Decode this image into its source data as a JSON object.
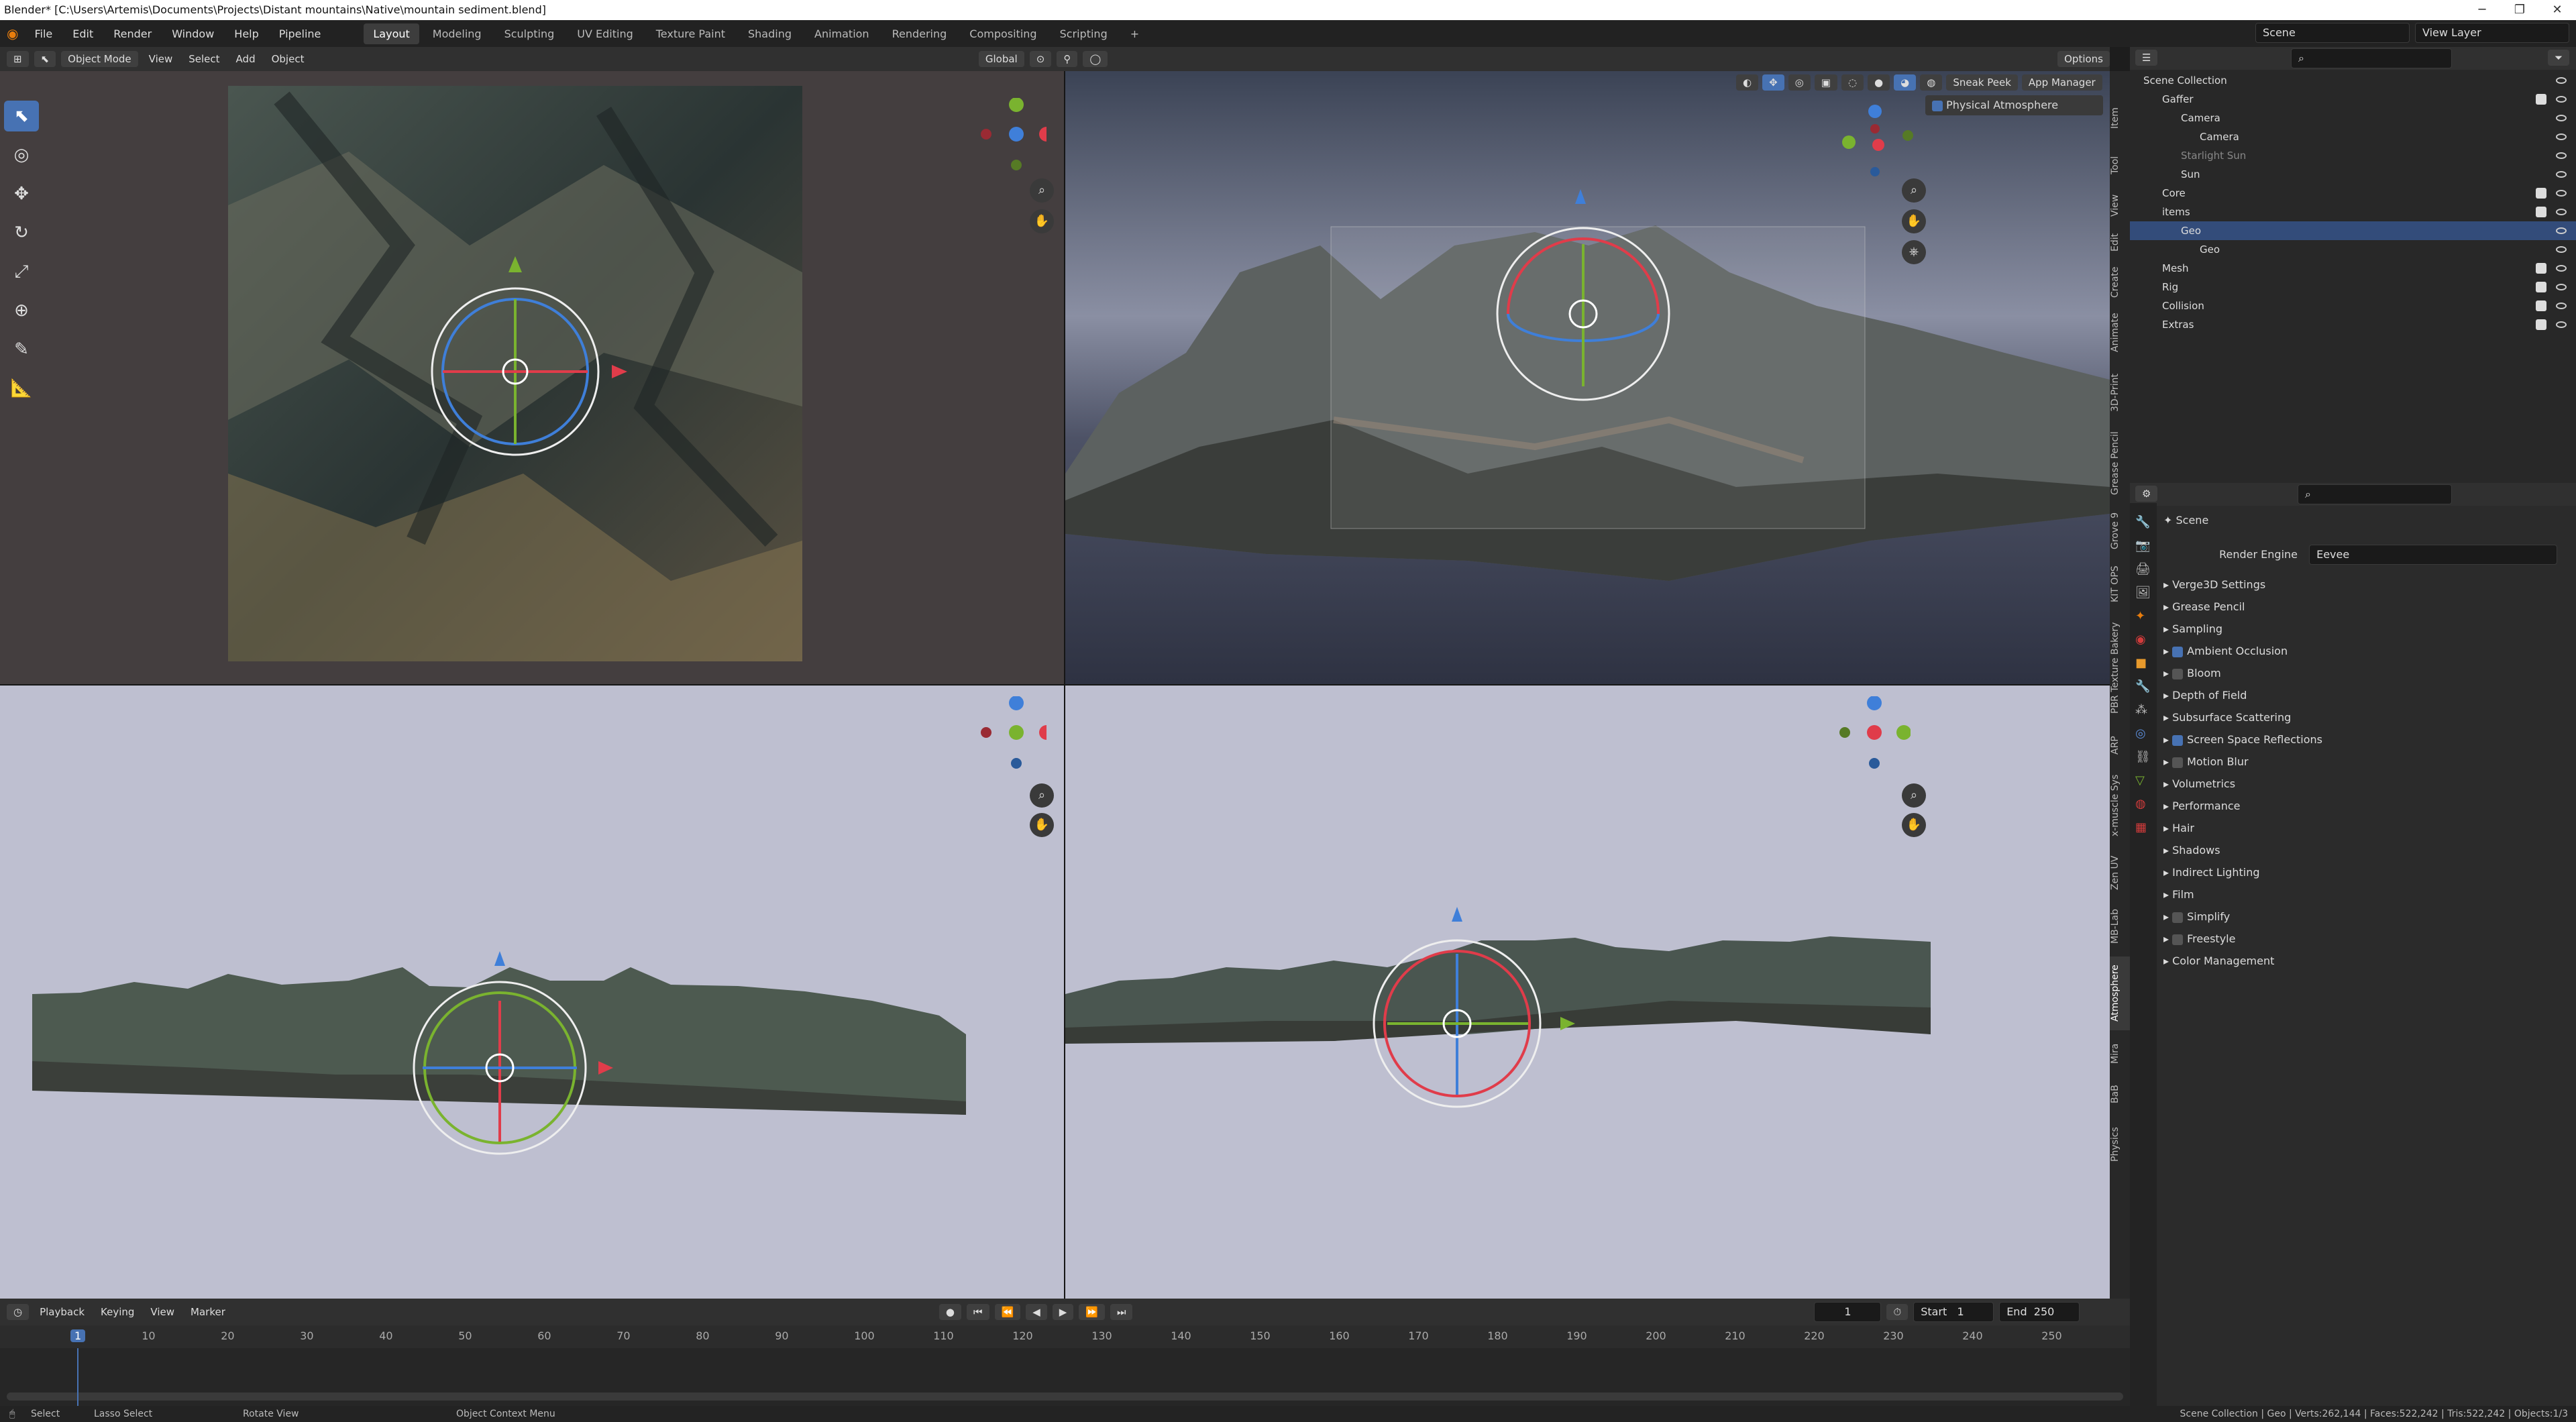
{
  "titlebar": {
    "title": "Blender* [C:\\Users\\Artemis\\Documents\\Projects\\Distant mountains\\Native\\mountain sediment.blend]",
    "minimize": "─",
    "restore": "❐",
    "close": "✕"
  },
  "menu": {
    "items": [
      "File",
      "Edit",
      "Render",
      "Window",
      "Help",
      "Pipeline"
    ],
    "workspaces": [
      "Layout",
      "Modeling",
      "Sculpting",
      "UV Editing",
      "Texture Paint",
      "Shading",
      "Animation",
      "Rendering",
      "Compositing",
      "Scripting"
    ],
    "active_workspace": "Layout",
    "add_tab": "+",
    "scene": "Scene",
    "view_layer": "View Layer"
  },
  "viewport_header": {
    "mode": "Object Mode",
    "links": [
      "View",
      "Select",
      "Add",
      "Object"
    ],
    "orientation": "Global",
    "options": "Options",
    "sneak_peek": "Sneak Peek",
    "app_manager": "App Manager",
    "physical_atmosphere": "Physical Atmosphere"
  },
  "tools": [
    {
      "name": "select-box-tool",
      "glyph": "⬉",
      "active": true
    },
    {
      "name": "cursor-tool",
      "glyph": "◎",
      "active": false
    },
    {
      "name": "move-tool",
      "glyph": "✥",
      "active": false
    },
    {
      "name": "rotate-tool",
      "glyph": "↻",
      "active": false
    },
    {
      "name": "scale-tool",
      "glyph": "⤢",
      "active": false
    },
    {
      "name": "transform-tool",
      "glyph": "⊕",
      "active": false
    },
    {
      "name": "annotate-tool",
      "glyph": "✎",
      "active": false
    },
    {
      "name": "measure-tool",
      "glyph": "📐",
      "active": false
    }
  ],
  "ntabs": [
    "Item",
    "Tool",
    "View",
    "Edit",
    "Create",
    "Animate",
    "3D-Print",
    "Grease Pencil",
    "Grove 9",
    "KIT OPS",
    "PBR Texture Bakery",
    "ARP",
    "x-muscle Sys",
    "Zen UV",
    "MB-Lab",
    "Atmosphere",
    "Mira",
    "BaB",
    "Physics"
  ],
  "outliner": {
    "search_placeholder": "",
    "rows": [
      {
        "label": "Scene Collection",
        "indent": 0,
        "selected": false,
        "checks": false,
        "dim": false
      },
      {
        "label": "Gaffer",
        "indent": 1,
        "selected": false,
        "checks": true,
        "dim": false
      },
      {
        "label": "Camera",
        "indent": 2,
        "selected": false,
        "checks": false,
        "dim": false
      },
      {
        "label": "Camera",
        "indent": 3,
        "selected": false,
        "checks": false,
        "dim": false
      },
      {
        "label": "Starlight Sun",
        "indent": 2,
        "selected": false,
        "checks": false,
        "dim": true
      },
      {
        "label": "Sun",
        "indent": 2,
        "selected": false,
        "checks": false,
        "dim": false
      },
      {
        "label": "Core",
        "indent": 1,
        "selected": false,
        "checks": true,
        "dim": false
      },
      {
        "label": "items",
        "indent": 1,
        "selected": false,
        "checks": true,
        "dim": false
      },
      {
        "label": "Geo",
        "indent": 2,
        "selected": true,
        "checks": false,
        "dim": false
      },
      {
        "label": "Geo",
        "indent": 3,
        "selected": false,
        "checks": false,
        "dim": false
      },
      {
        "label": "Mesh",
        "indent": 1,
        "selected": false,
        "checks": true,
        "dim": false
      },
      {
        "label": "Rig",
        "indent": 1,
        "selected": false,
        "checks": true,
        "dim": false
      },
      {
        "label": "Collision",
        "indent": 1,
        "selected": false,
        "checks": true,
        "dim": false
      },
      {
        "label": "Extras",
        "indent": 1,
        "selected": false,
        "checks": true,
        "dim": false
      }
    ]
  },
  "properties": {
    "context": "Scene",
    "render_engine_label": "Render Engine",
    "render_engine": "Eevee",
    "panels": [
      {
        "label": "Verge3D Settings",
        "checkbox": null
      },
      {
        "label": "Grease Pencil",
        "checkbox": null
      },
      {
        "label": "Sampling",
        "checkbox": null
      },
      {
        "label": "Ambient Occlusion",
        "checkbox": true
      },
      {
        "label": "Bloom",
        "checkbox": false
      },
      {
        "label": "Depth of Field",
        "checkbox": null
      },
      {
        "label": "Subsurface Scattering",
        "checkbox": null
      },
      {
        "label": "Screen Space Reflections",
        "checkbox": true
      },
      {
        "label": "Motion Blur",
        "checkbox": false
      },
      {
        "label": "Volumetrics",
        "checkbox": null
      },
      {
        "label": "Performance",
        "checkbox": null
      },
      {
        "label": "Hair",
        "checkbox": null
      },
      {
        "label": "Shadows",
        "checkbox": null
      },
      {
        "label": "Indirect Lighting",
        "checkbox": null
      },
      {
        "label": "Film",
        "checkbox": null
      },
      {
        "label": "Simplify",
        "checkbox": false
      },
      {
        "label": "Freestyle",
        "checkbox": false
      },
      {
        "label": "Color Management",
        "checkbox": null
      }
    ]
  },
  "timeline": {
    "menus": [
      "Playback",
      "Keying",
      "View",
      "Marker"
    ],
    "current_frame": "1",
    "start_label": "Start",
    "start": "1",
    "end_label": "End",
    "end": "250",
    "ticks": [
      "1",
      "10",
      "20",
      "30",
      "40",
      "50",
      "60",
      "70",
      "80",
      "90",
      "100",
      "110",
      "120",
      "130",
      "140",
      "150",
      "160",
      "170",
      "180",
      "190",
      "200",
      "210",
      "220",
      "230",
      "240",
      "250"
    ]
  },
  "statusbar": {
    "select": "Select",
    "lasso": "Lasso Select",
    "rotate": "Rotate View",
    "context_menu": "Object Context Menu",
    "stats": "Scene Collection | Geo | Verts:262,144 | Faces:522,242 | Tris:522,242 | Objects:1/3"
  },
  "colors": {
    "accent": "#4772b3",
    "x_axis": "#e03c4a",
    "y_axis": "#7ab32f",
    "z_axis": "#3f7fd9"
  }
}
